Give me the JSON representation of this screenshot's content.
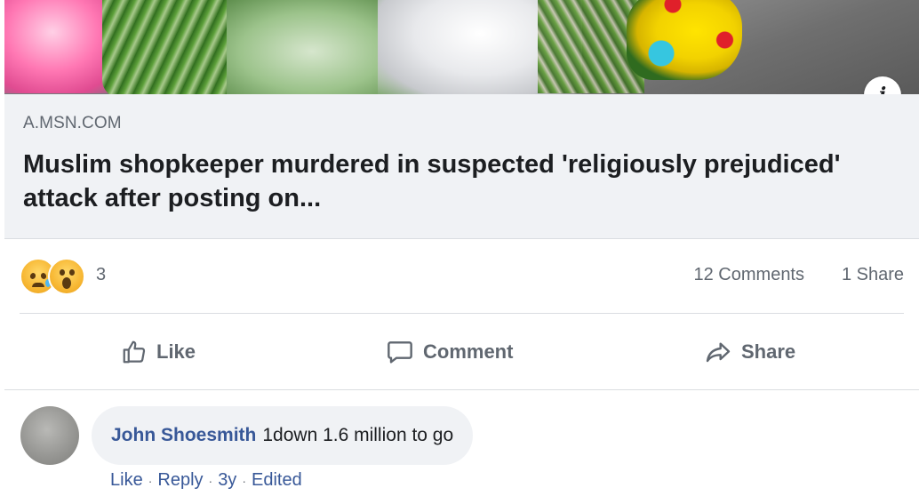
{
  "link_preview": {
    "domain": "A.MSN.COM",
    "title": "Muslim shopkeeper murdered in suspected 'religiously prejudiced' attack after posting on...",
    "info_icon": "info-icon",
    "info_glyph": "i"
  },
  "reactions": {
    "icons": [
      "sad-reaction-icon",
      "wow-reaction-icon"
    ],
    "count": "3",
    "comments": "12 Comments",
    "shares": "1 Share"
  },
  "actions": {
    "like": "Like",
    "comment": "Comment",
    "share": "Share"
  },
  "comment": {
    "author": "John Shoesmith",
    "text": "1down 1.6 million to go",
    "like": "Like",
    "reply": "Reply",
    "time": "3y",
    "edited": "Edited",
    "separator": "·"
  },
  "colors": {
    "link_blue": "#385898",
    "secondary_text": "#606770",
    "box_background": "#f0f2f5"
  }
}
